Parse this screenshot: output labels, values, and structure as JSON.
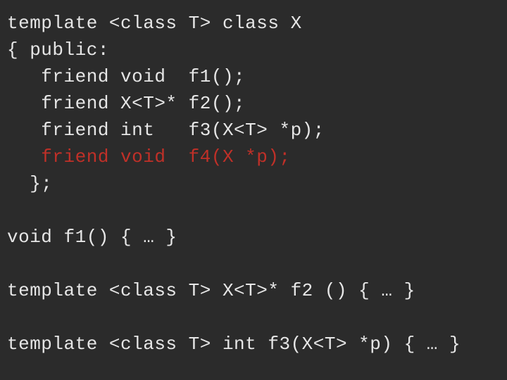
{
  "lines": [
    {
      "text": "template <class T> class X",
      "highlight": false
    },
    {
      "text": "{ public:",
      "highlight": false
    },
    {
      "text": "   friend void  f1();",
      "highlight": false
    },
    {
      "text": "   friend X<T>* f2();",
      "highlight": false
    },
    {
      "text": "   friend int   f3(X<T> *p);",
      "highlight": false
    },
    {
      "text": "   friend void  f4(X *p);",
      "highlight": true
    },
    {
      "text": "  };",
      "highlight": false
    },
    {
      "text": "",
      "highlight": false
    },
    {
      "text": "void f1() { … }",
      "highlight": false
    },
    {
      "text": "",
      "highlight": false
    },
    {
      "text": "template <class T> X<T>* f2 () { … }",
      "highlight": false
    },
    {
      "text": "",
      "highlight": false
    },
    {
      "text": "template <class T> int f3(X<T> *p) { … }",
      "highlight": false
    }
  ]
}
